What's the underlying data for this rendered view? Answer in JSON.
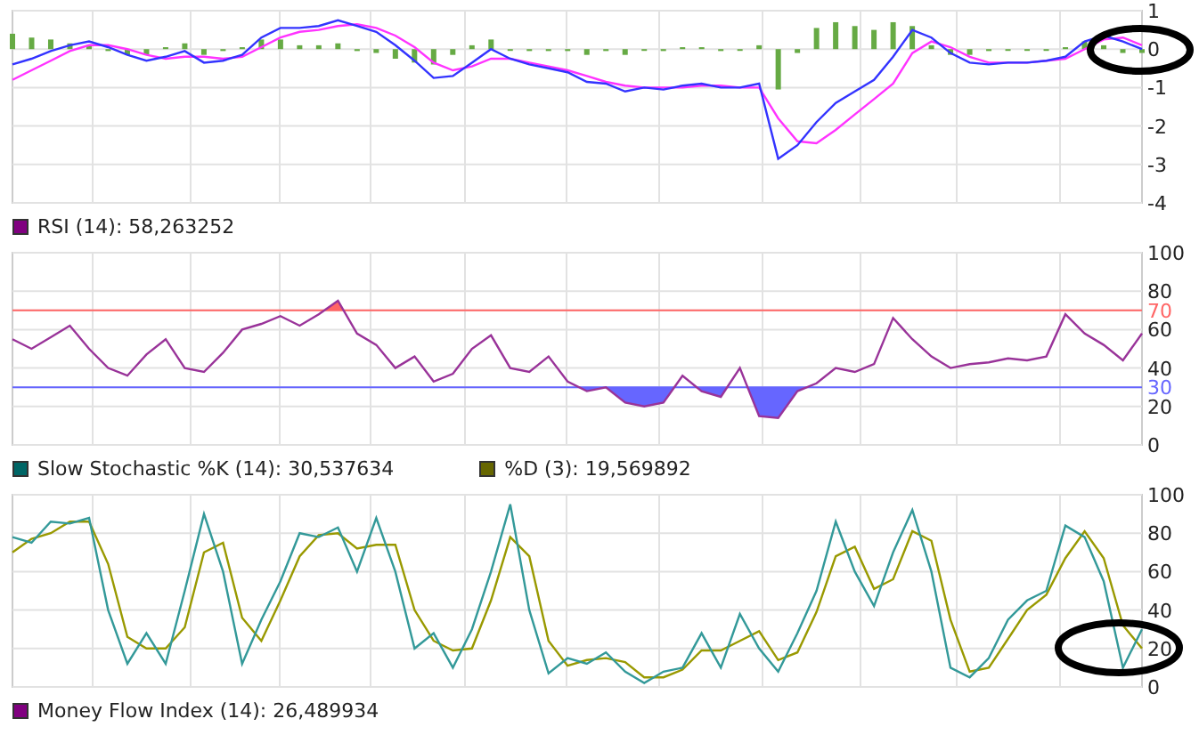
{
  "panels": [
    {
      "chart_data": {
        "type": "line",
        "grid": true,
        "ylim": [
          -4,
          1
        ],
        "yticks": [
          1,
          0,
          -1,
          -2,
          -3,
          -4
        ],
        "series": [
          {
            "type": "bar",
            "color": "#66aa44",
            "values": [
              0.4,
              0.3,
              0.25,
              0.15,
              0.1,
              -0.05,
              -0.15,
              -0.15,
              0.05,
              0.15,
              -0.15,
              -0.05,
              0.05,
              0.25,
              0.25,
              0.1,
              0.1,
              0.15,
              -0.05,
              -0.1,
              -0.25,
              -0.35,
              -0.4,
              -0.15,
              0.1,
              0.25,
              0.0,
              -0.05,
              -0.05,
              -0.05,
              -0.15,
              -0.05,
              -0.15,
              0.0,
              -0.05,
              0.05,
              0.05,
              -0.05,
              0.0,
              0.1,
              -1.05,
              -0.1,
              0.55,
              0.7,
              0.6,
              0.5,
              0.7,
              0.6,
              0.1,
              -0.15,
              -0.15,
              -0.05,
              0.0,
              0.0,
              0.0,
              0.05,
              0.2,
              0.1,
              -0.1,
              -0.1
            ]
          },
          {
            "color": "#ff33ff",
            "values": [
              -0.8,
              -0.55,
              -0.3,
              -0.05,
              0.1,
              0.1,
              0.0,
              -0.15,
              -0.25,
              -0.2,
              -0.2,
              -0.25,
              -0.2,
              0.05,
              0.3,
              0.45,
              0.5,
              0.6,
              0.65,
              0.55,
              0.35,
              0.05,
              -0.35,
              -0.55,
              -0.45,
              -0.25,
              -0.25,
              -0.35,
              -0.45,
              -0.55,
              -0.7,
              -0.85,
              -0.95,
              -1.0,
              -1.0,
              -1.0,
              -0.95,
              -0.95,
              -1.0,
              -1.0,
              -1.8,
              -2.4,
              -2.45,
              -2.1,
              -1.7,
              -1.3,
              -0.9,
              -0.1,
              0.2,
              0.05,
              -0.2,
              -0.35,
              -0.35,
              -0.35,
              -0.3,
              -0.25,
              0.0,
              0.25,
              0.3,
              0.1
            ]
          },
          {
            "color": "#3333ff",
            "values": [
              -0.4,
              -0.25,
              -0.05,
              0.1,
              0.2,
              0.05,
              -0.15,
              -0.3,
              -0.2,
              -0.05,
              -0.35,
              -0.3,
              -0.15,
              0.3,
              0.55,
              0.55,
              0.6,
              0.75,
              0.6,
              0.45,
              0.1,
              -0.3,
              -0.75,
              -0.7,
              -0.35,
              0.0,
              -0.25,
              -0.4,
              -0.5,
              -0.6,
              -0.85,
              -0.9,
              -1.1,
              -1.0,
              -1.05,
              -0.95,
              -0.9,
              -1.0,
              -1.0,
              -0.9,
              -2.85,
              -2.5,
              -1.9,
              -1.4,
              -1.1,
              -0.8,
              -0.2,
              0.5,
              0.3,
              -0.1,
              -0.35,
              -0.4,
              -0.35,
              -0.35,
              -0.3,
              -0.2,
              0.2,
              0.35,
              0.2,
              0.0
            ]
          }
        ]
      }
    },
    {
      "legend": [
        {
          "label": "RSI (14): 58,263252",
          "color": "#800080"
        }
      ],
      "chart_data": {
        "type": "line",
        "grid": true,
        "ylim": [
          0,
          100
        ],
        "yticks": [
          100,
          80,
          70,
          60,
          40,
          30,
          20,
          0
        ],
        "series": [
          {
            "color": "#993399",
            "values": [
              55,
              50,
              56,
              62,
              50,
              40,
              36,
              47,
              55,
              40,
              38,
              48,
              60,
              63,
              67,
              62,
              68,
              75,
              58,
              52,
              40,
              46,
              33,
              37,
              50,
              57,
              40,
              38,
              46,
              33,
              28,
              30,
              22,
              20,
              22,
              36,
              28,
              25,
              40,
              15,
              14,
              28,
              32,
              40,
              38,
              42,
              66,
              55,
              46,
              40,
              42,
              43,
              45,
              44,
              46,
              68,
              58,
              52,
              44,
              58
            ]
          }
        ],
        "ref_lines": [
          {
            "axis": "y",
            "value": 70,
            "color": "#ff6666"
          },
          {
            "axis": "y",
            "value": 30,
            "color": "#6666ff"
          }
        ]
      }
    },
    {
      "legend": [
        {
          "label": "Slow Stochastic %K (14): 30,537634",
          "color": "#006666"
        },
        {
          "label": "%D (3): 19,569892",
          "color": "#666600"
        }
      ],
      "chart_data": {
        "type": "line",
        "grid": true,
        "ylim": [
          0,
          100
        ],
        "yticks": [
          100,
          80,
          60,
          40,
          20,
          0
        ],
        "series": [
          {
            "color": "#999900",
            "values": [
              70,
              77,
              80,
              86,
              86,
              64,
              26,
              20,
              20,
              31,
              70,
              75,
              36,
              24,
              45,
              68,
              79,
              80,
              72,
              74,
              74,
              40,
              24,
              19,
              20,
              45,
              78,
              68,
              24,
              11,
              14,
              15,
              13,
              5,
              5,
              9,
              19,
              19,
              24,
              29,
              14,
              18,
              39,
              68,
              73,
              51,
              56,
              81,
              76,
              35,
              8,
              10,
              25,
              40,
              48,
              67,
              81,
              67,
              32,
              20
            ]
          },
          {
            "color": "#339999",
            "values": [
              78,
              75,
              86,
              85,
              88,
              40,
              12,
              28,
              12,
              50,
              90,
              60,
              12,
              35,
              55,
              80,
              78,
              83,
              60,
              88,
              60,
              20,
              28,
              10,
              30,
              60,
              95,
              40,
              7,
              15,
              12,
              18,
              8,
              2,
              8,
              10,
              28,
              10,
              38,
              20,
              8,
              28,
              50,
              86,
              60,
              42,
              70,
              92,
              60,
              10,
              5,
              15,
              35,
              45,
              50,
              84,
              78,
              55,
              10,
              30
            ]
          }
        ]
      }
    }
  ],
  "footer_legend": [
    {
      "label": "Money Flow Index (14): 26,489934",
      "color": "#800080"
    }
  ]
}
